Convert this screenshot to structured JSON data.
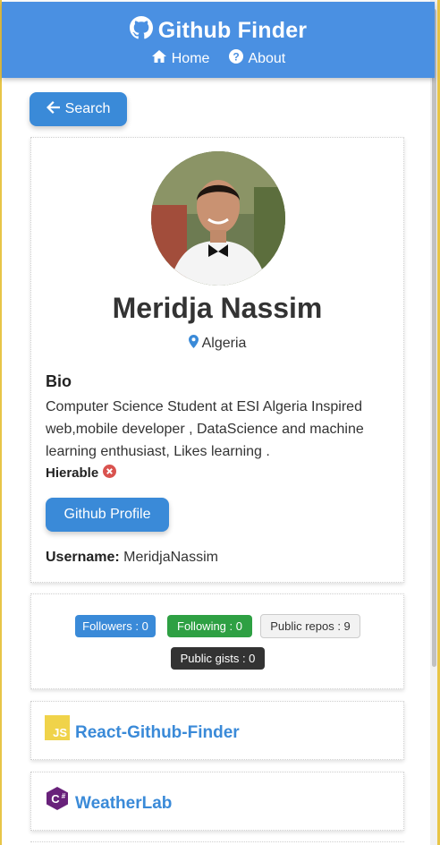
{
  "navbar": {
    "brand": "Github Finder",
    "brand_icon": "github-icon",
    "links": [
      {
        "label": "Home",
        "icon": "home-icon"
      },
      {
        "label": "About",
        "icon": "question-circle-icon"
      }
    ]
  },
  "back_button": {
    "label": "Search",
    "icon": "arrow-left-icon"
  },
  "profile": {
    "name": "Meridja Nassim",
    "location": "Algeria",
    "bio_title": "Bio",
    "bio": "Computer Science Student at ESI Algeria Inspired web,mobile developer , DataScience and machine learning enthusiast, Likes learning .",
    "hireable_label": "Hierable",
    "github_button": "Github Profile",
    "username_label": "Username:",
    "username": "MeridjaNassim"
  },
  "stats": {
    "followers": "Followers : 0",
    "following": "Following : 0",
    "public_repos": "Public repos : 9",
    "public_gists": "Public gists : 0"
  },
  "repos": [
    {
      "name": "React-Github-Finder",
      "language_icon": "js-icon"
    },
    {
      "name": "WeatherLab",
      "language_icon": "csharp-icon"
    }
  ],
  "colors": {
    "primary": "#4a90e2",
    "success": "#2ea043",
    "dark": "#333333",
    "light": "#f2f2f2",
    "danger": "#d9534f"
  }
}
